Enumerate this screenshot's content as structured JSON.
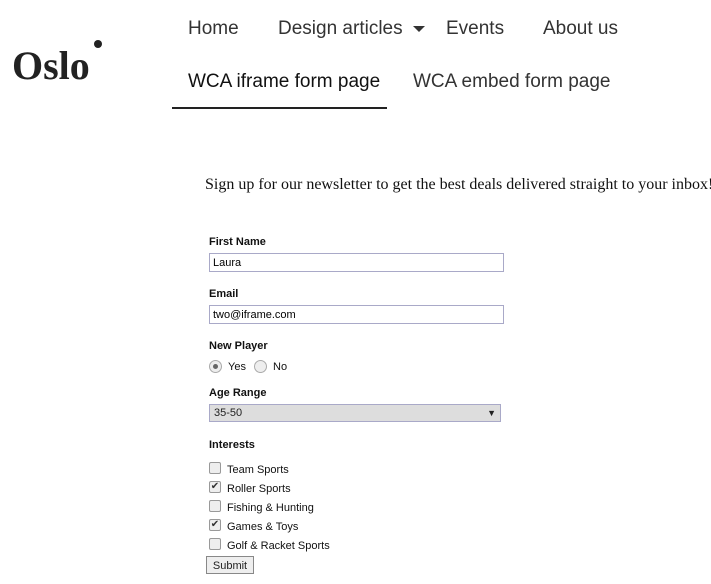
{
  "site": {
    "logo": "Oslo"
  },
  "nav": {
    "items": [
      "Home",
      "Design articles",
      "Events",
      "About us",
      "WCA iframe form page",
      "WCA embed form page"
    ],
    "active": "WCA iframe form page"
  },
  "intro": "Sign up for our newsletter to get the best deals delivered straight to your inbox!",
  "form": {
    "first_name": {
      "label": "First Name",
      "value": "Laura"
    },
    "email": {
      "label": "Email",
      "value": "two@iframe.com"
    },
    "new_player": {
      "label": "New Player",
      "options": [
        "Yes",
        "No"
      ],
      "selected": "Yes"
    },
    "age_range": {
      "label": "Age Range",
      "value": "35-50"
    },
    "interests": {
      "label": "Interests",
      "options": [
        {
          "label": "Team Sports",
          "checked": false
        },
        {
          "label": "Roller Sports",
          "checked": true
        },
        {
          "label": "Fishing & Hunting",
          "checked": false
        },
        {
          "label": "Games & Toys",
          "checked": true
        },
        {
          "label": "Golf & Racket Sports",
          "checked": false
        }
      ]
    },
    "submit": "Submit"
  }
}
